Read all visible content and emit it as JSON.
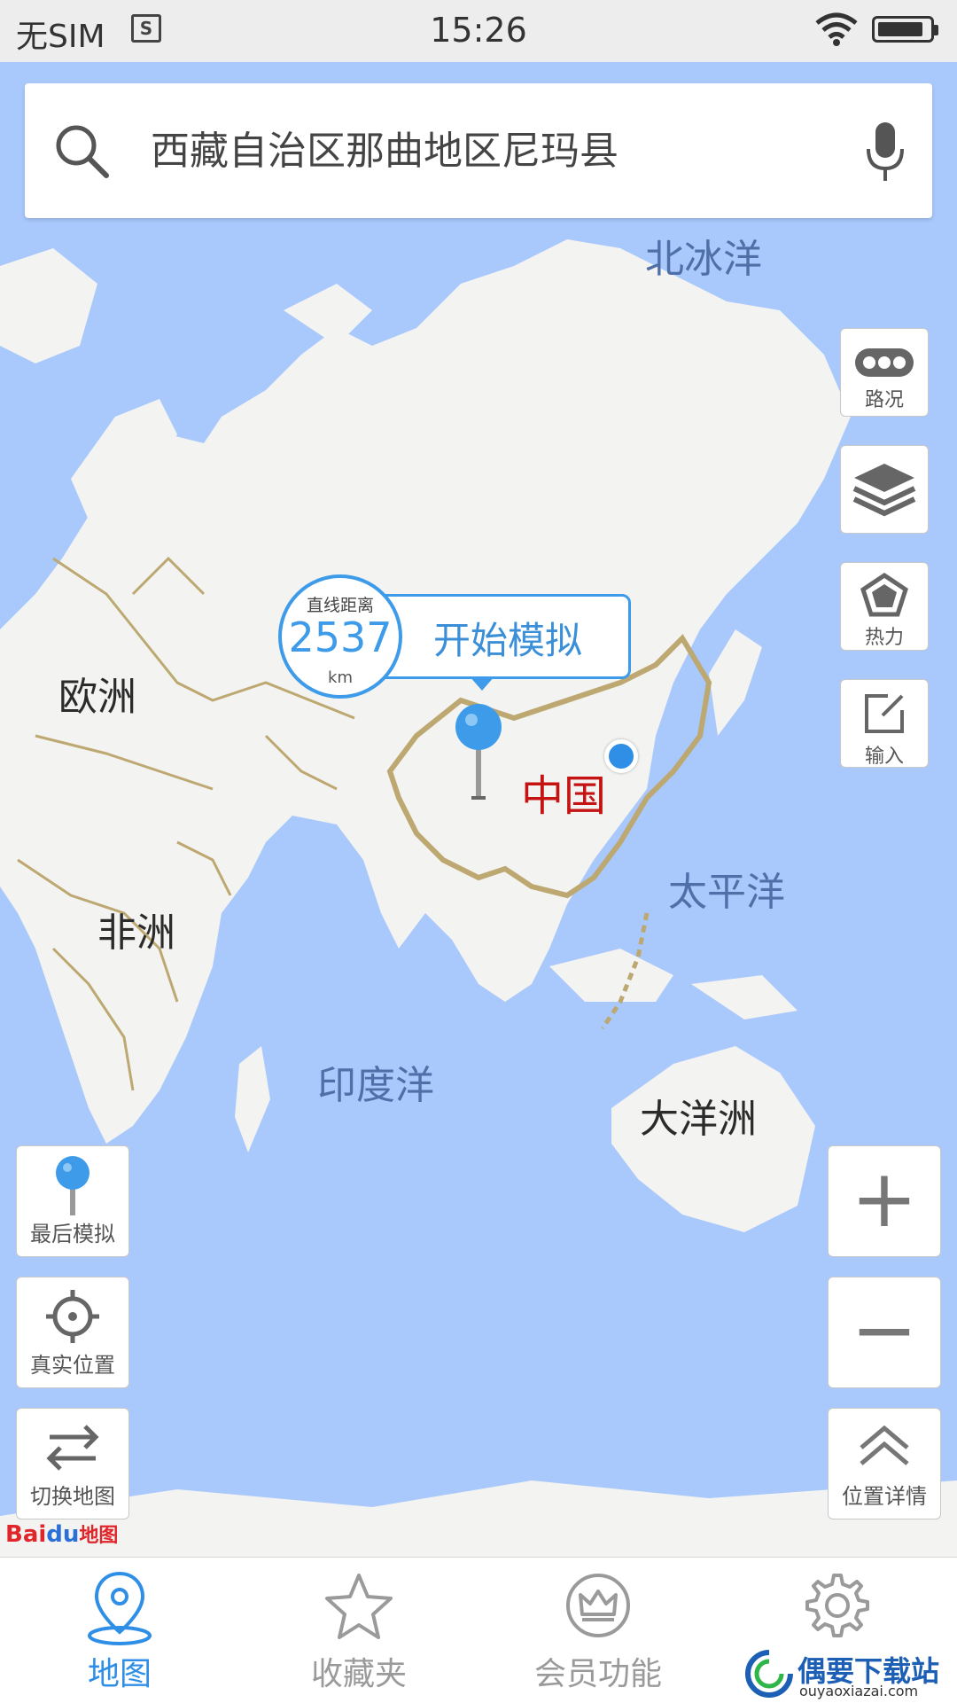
{
  "status_bar": {
    "carrier": "无SIM",
    "sim_icon_glyph": "S",
    "time": "15:26",
    "icons": [
      "sim-card-icon",
      "wifi-icon",
      "battery-icon"
    ]
  },
  "search": {
    "value": "西藏自治区那曲地区尼玛县",
    "icons": [
      "search-icon",
      "mic-icon"
    ]
  },
  "map": {
    "labels": {
      "arctic": "北冰洋",
      "europe": "欧洲",
      "africa": "非洲",
      "china": "中国",
      "pacific": "太平洋",
      "indian": "印度洋",
      "oceania": "大洋洲"
    },
    "colors": {
      "water": "#a9c8fb",
      "land": "#f3f3f1",
      "border": "#bda872",
      "china_label": "#c51313",
      "accent": "#3d9be9"
    }
  },
  "distance_callout": {
    "label": "直线距离",
    "value": "2537",
    "unit": "km",
    "action": "开始模拟"
  },
  "right_tools": {
    "traffic": "路况",
    "heat": "热力",
    "input": "输入"
  },
  "right_controls": {
    "zoom_in": "+",
    "zoom_out": "−",
    "location_detail": "位置详情"
  },
  "left_controls": {
    "last_simulation": "最后模拟",
    "real_location": "真实位置",
    "switch_map": "切换地图"
  },
  "baidu_logo": {
    "part1": "Bai",
    "part2": "du",
    "part3": "地图"
  },
  "bottom_nav": {
    "items": [
      {
        "label": "地图",
        "icon": "map-pin-icon",
        "active": true
      },
      {
        "label": "收藏夹",
        "icon": "star-icon",
        "active": false
      },
      {
        "label": "会员功能",
        "icon": "crown-icon",
        "active": false
      },
      {
        "label": "设置",
        "icon": "gear-icon",
        "active": false
      }
    ]
  },
  "watermark": {
    "title": "偶要下载站",
    "subtitle": "ouyaoxiazai.com"
  }
}
